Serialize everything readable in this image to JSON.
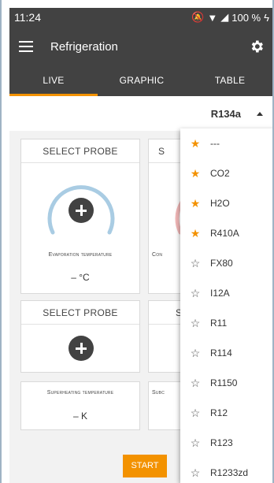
{
  "status": {
    "time": "11:24",
    "battery": "100 %"
  },
  "appbar": {
    "title": "Refrigeration",
    "menu_icon": "menu-icon",
    "settings_icon": "gear-icon"
  },
  "tabs": [
    {
      "label": "LIVE",
      "active": true
    },
    {
      "label": "GRAPHIC",
      "active": false
    },
    {
      "label": "TABLE",
      "active": false
    }
  ],
  "refrigerant": {
    "selected": "R134a"
  },
  "cards": {
    "probe1": {
      "header": "SELECT PROBE",
      "label": "Evaporation temperature",
      "value": "– °C"
    },
    "probe2": {
      "header": "S",
      "label": "Con",
      "value": ""
    },
    "probe3": {
      "header": "SELECT PROBE"
    },
    "probe4": {
      "header": "S"
    },
    "superheat": {
      "label": "Superheating temperature",
      "value": "– K"
    },
    "subcool": {
      "label": "Subc"
    }
  },
  "start_button": "START",
  "colors": {
    "accent": "#f39200",
    "appbar": "#424242",
    "gauge_blue": "#a9cce3",
    "gauge_red": "#f2b8b8"
  },
  "dropdown": {
    "items": [
      {
        "label": "---",
        "favorite": true
      },
      {
        "label": "CO2",
        "favorite": true
      },
      {
        "label": "H2O",
        "favorite": true
      },
      {
        "label": "R410A",
        "favorite": true
      },
      {
        "label": "FX80",
        "favorite": false
      },
      {
        "label": "I12A",
        "favorite": false
      },
      {
        "label": "R11",
        "favorite": false
      },
      {
        "label": "R114",
        "favorite": false
      },
      {
        "label": "R1150",
        "favorite": false
      },
      {
        "label": "R12",
        "favorite": false
      },
      {
        "label": "R123",
        "favorite": false
      },
      {
        "label": "R1233zd",
        "favorite": false
      }
    ]
  }
}
